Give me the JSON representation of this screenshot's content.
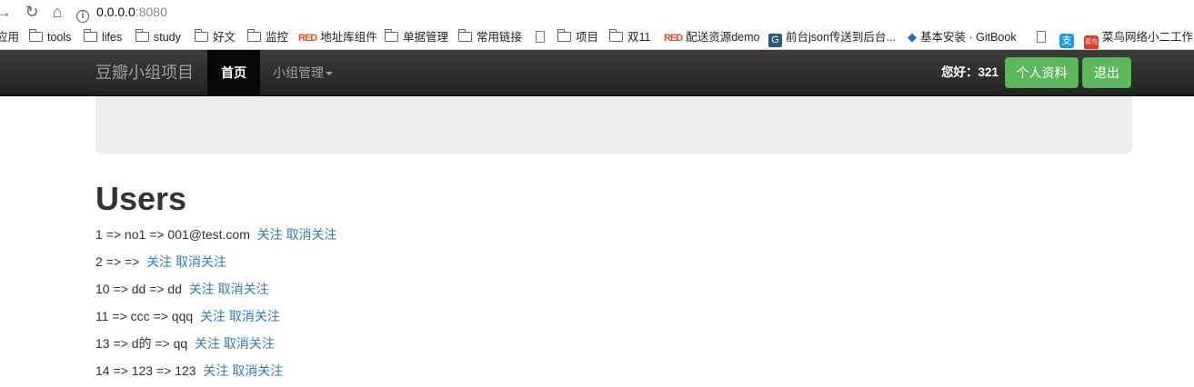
{
  "browser": {
    "url_host": "0.0.0.0",
    "url_port": ":8080"
  },
  "bookmarks": [
    {
      "label": "应用",
      "icon": "apps-icon"
    },
    {
      "label": "tools",
      "icon": "folder-icon"
    },
    {
      "label": "lifes",
      "icon": "folder-icon"
    },
    {
      "label": "study",
      "icon": "folder-icon"
    },
    {
      "label": "好文",
      "icon": "folder-icon"
    },
    {
      "label": "监控",
      "icon": "folder-icon"
    },
    {
      "label": "地址库组件",
      "icon": "red-logo-icon"
    },
    {
      "label": "单据管理",
      "icon": "folder-icon"
    },
    {
      "label": "常用链接",
      "icon": "folder-icon"
    },
    {
      "label": "",
      "icon": "page-icon"
    },
    {
      "label": "项目",
      "icon": "folder-icon"
    },
    {
      "label": "双11",
      "icon": "folder-icon"
    },
    {
      "label": "配送资源demo",
      "icon": "red-logo-icon"
    },
    {
      "label": "前台json传送到后台...",
      "icon": "github-icon"
    },
    {
      "label": "基本安装 · GitBook",
      "icon": "gitbook-icon"
    },
    {
      "label": "",
      "icon": "page-icon"
    },
    {
      "label": "",
      "icon": "alipay-icon"
    },
    {
      "label": "菜鸟网络小二工作台",
      "icon": "cainiao-icon"
    }
  ],
  "navbar": {
    "brand": "豆瓣小组项目",
    "home": "首页",
    "group_menu": "小组管理",
    "greeting": "您好：321",
    "profile_button": "个人资料",
    "logout_button": "退出"
  },
  "content": {
    "heading": "Users",
    "follow_label": "关注",
    "unfollow_label": "取消关注",
    "users": [
      {
        "text": "1 => no1 => 001@test.com"
      },
      {
        "text": "2 => =>"
      },
      {
        "text": "10 => dd => dd"
      },
      {
        "text": "11 => ccc => qqq"
      },
      {
        "text": "13 => d的 => qq"
      },
      {
        "text": "14 => 123 => 123"
      }
    ]
  }
}
